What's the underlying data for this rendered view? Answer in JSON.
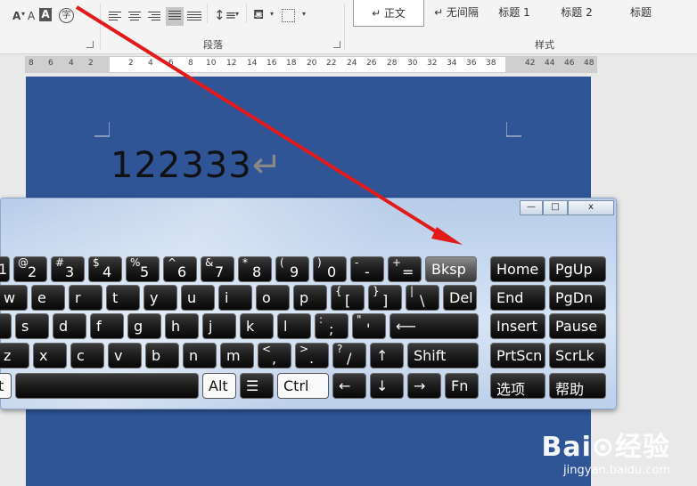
{
  "ribbon": {
    "font_items": [
      "A",
      "A",
      "字"
    ],
    "paragraph_label": "段落",
    "styles_label": "样式",
    "styles": [
      "↵ 正文",
      "↵ 无间隔",
      "标题 1",
      "标题 2",
      "标题"
    ]
  },
  "ruler": [
    "8",
    "6",
    "4",
    "2",
    "2",
    "4",
    "6",
    "8",
    "10",
    "12",
    "14",
    "16",
    "18",
    "20",
    "22",
    "24",
    "26",
    "28",
    "30",
    "32",
    "34",
    "36",
    "38",
    "42",
    "44",
    "46",
    "48"
  ],
  "document": {
    "text": "122333",
    "para_mark": "↵"
  },
  "osk": {
    "window_buttons": [
      "—",
      "□",
      "x"
    ],
    "rows": [
      [
        {
          "label": "1",
          "w": 14,
          "partial": true
        },
        {
          "top": "@",
          "label": "2"
        },
        {
          "top": "#",
          "label": "3"
        },
        {
          "top": "$",
          "label": "4"
        },
        {
          "top": "%",
          "label": "5"
        },
        {
          "top": "^",
          "label": "6"
        },
        {
          "top": "&",
          "label": "7"
        },
        {
          "top": "*",
          "label": "8"
        },
        {
          "top": "(",
          "label": "9"
        },
        {
          "top": ")",
          "label": "0"
        },
        {
          "top": "-",
          "label": "-"
        },
        {
          "top": "+",
          "label": "="
        },
        {
          "label": "Bksp",
          "grey": true,
          "w": 58
        },
        {
          "label": "Home",
          "w": 62
        },
        {
          "label": "PgUp",
          "w": 64
        }
      ],
      [
        {
          "label": "w"
        },
        {
          "label": "e"
        },
        {
          "label": "r"
        },
        {
          "label": "t"
        },
        {
          "label": "y"
        },
        {
          "label": "u"
        },
        {
          "label": "i"
        },
        {
          "label": "o"
        },
        {
          "label": "p"
        },
        {
          "top": "{",
          "label": "["
        },
        {
          "top": "}",
          "label": "]"
        },
        {
          "top": "|",
          "label": "\\"
        },
        {
          "label": "Del"
        },
        {
          "label": "End",
          "w": 62
        },
        {
          "label": "PgDn",
          "w": 64
        }
      ],
      [
        {
          "label": "",
          "w": 16,
          "partial": true
        },
        {
          "label": "s"
        },
        {
          "label": "d"
        },
        {
          "label": "f"
        },
        {
          "label": "g"
        },
        {
          "label": "h"
        },
        {
          "label": "j"
        },
        {
          "label": "k"
        },
        {
          "label": "l"
        },
        {
          "top": ":",
          "label": ";"
        },
        {
          "top": "\"",
          "label": "'"
        },
        {
          "label": "⟵",
          "w": 100
        },
        {
          "label": "Insert",
          "w": 62
        },
        {
          "label": "Pause",
          "w": 64
        }
      ],
      [
        {
          "label": "z",
          "w": 36
        },
        {
          "label": "x"
        },
        {
          "label": "c"
        },
        {
          "label": "v"
        },
        {
          "label": "b"
        },
        {
          "label": "n"
        },
        {
          "label": "m"
        },
        {
          "top": "<",
          "label": ","
        },
        {
          "top": ">",
          "label": "."
        },
        {
          "top": "?",
          "label": "/"
        },
        {
          "label": "↑"
        },
        {
          "label": "Shift",
          "w": 80
        },
        {
          "label": "PrtScn",
          "w": 62
        },
        {
          "label": "ScrLk",
          "w": 64
        }
      ],
      [
        {
          "label": "t",
          "w": 16,
          "white": true,
          "partial": true
        },
        {
          "label": "",
          "w": 206
        },
        {
          "label": "Alt",
          "white": true
        },
        {
          "label": "☰"
        },
        {
          "label": "Ctrl",
          "white": true,
          "w": 58
        },
        {
          "label": "←"
        },
        {
          "label": "↓"
        },
        {
          "label": "→"
        },
        {
          "label": "Fn"
        },
        {
          "label": "选项",
          "w": 62
        },
        {
          "label": "帮助",
          "w": 64
        }
      ]
    ]
  },
  "watermark": {
    "logo": "Bai⊙经验",
    "url": "jingyan.baidu.com"
  },
  "colors": {
    "doc_bg": "#2f5597",
    "arrow": "#e31a1a"
  }
}
